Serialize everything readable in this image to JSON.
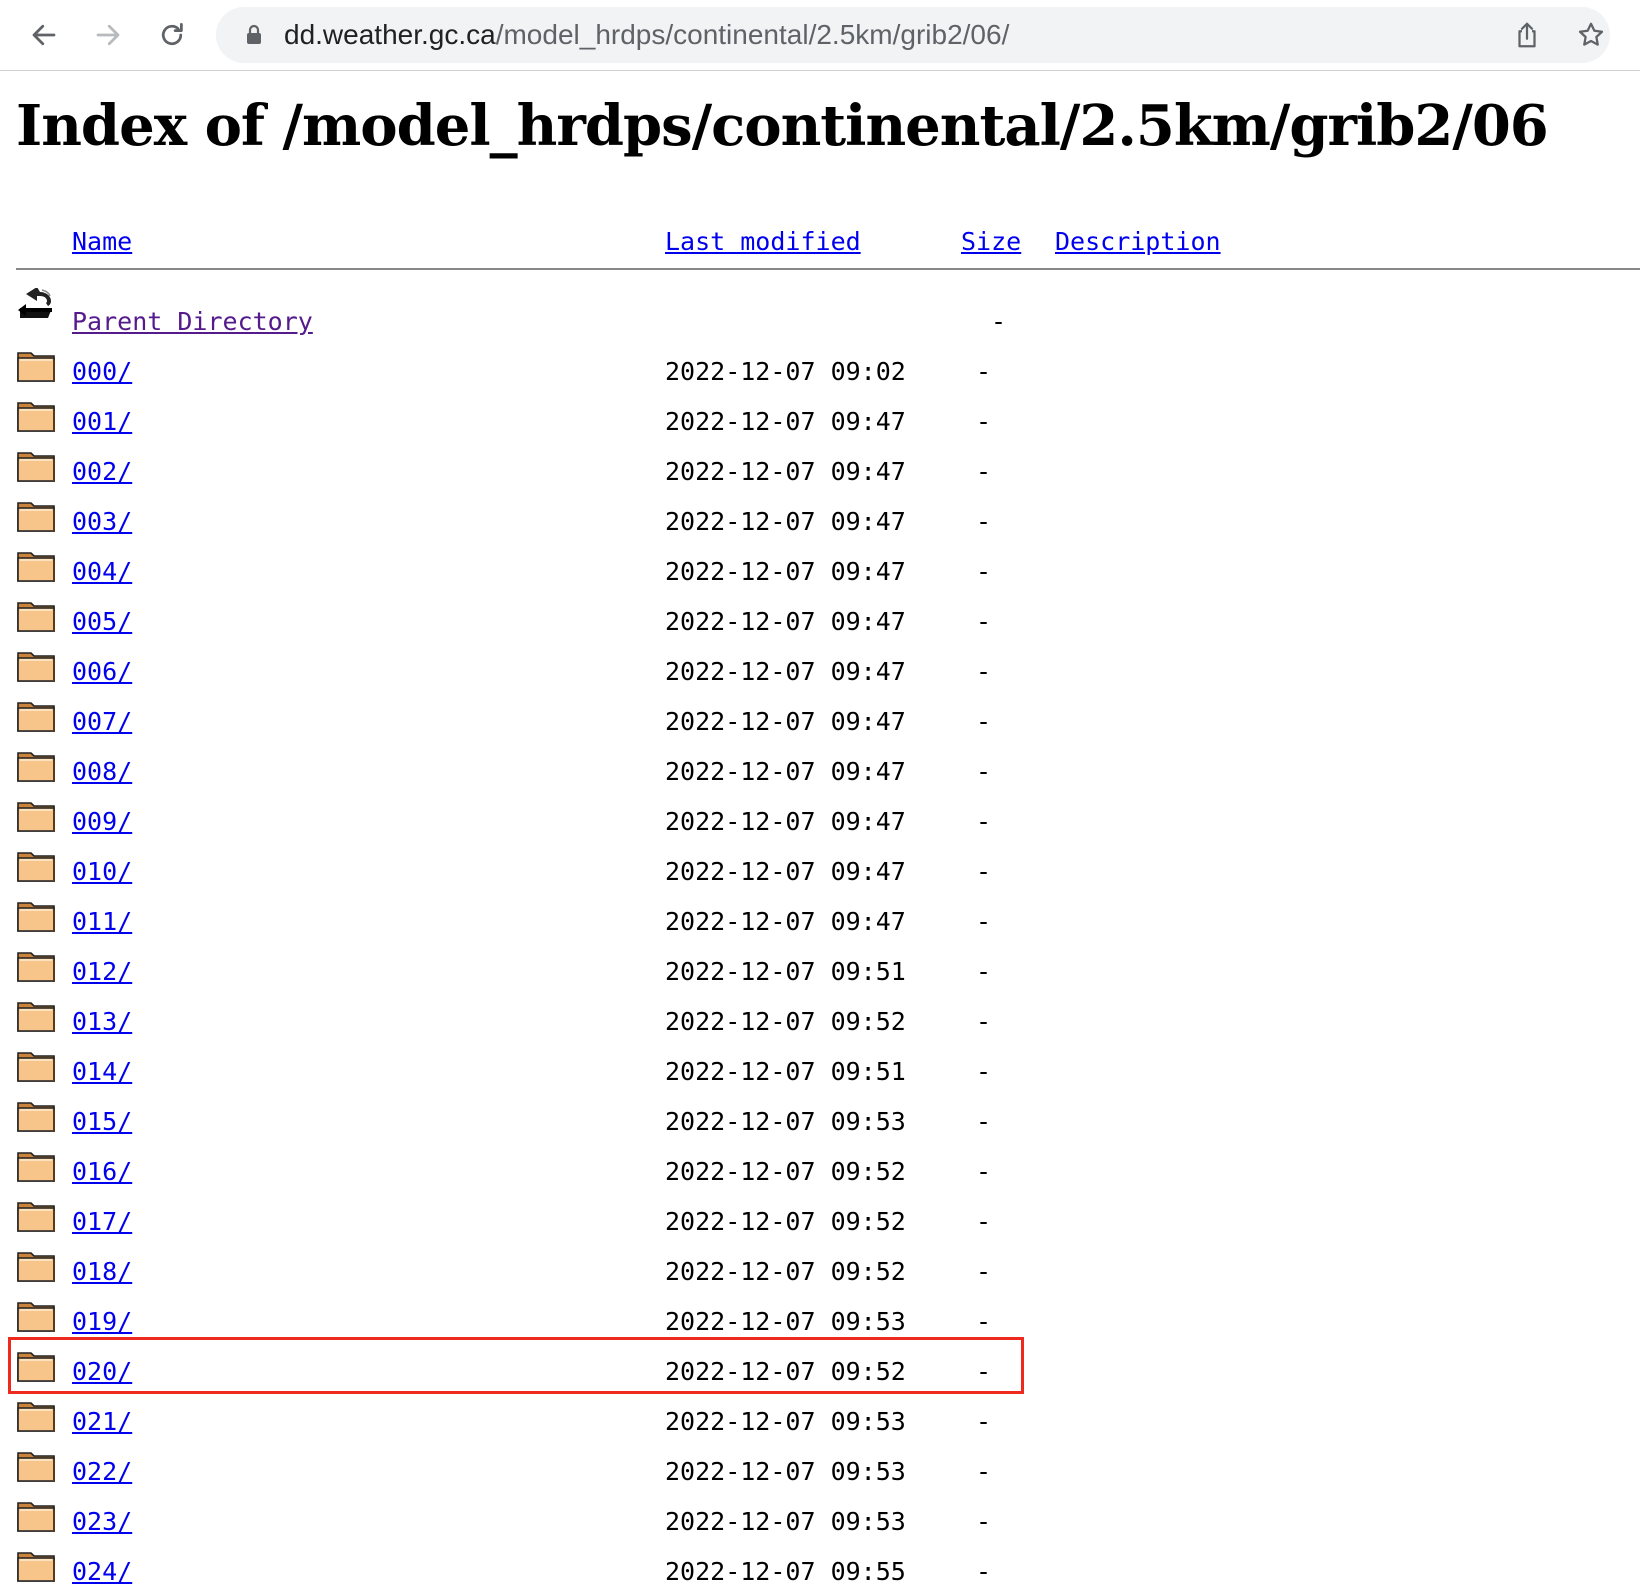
{
  "browser": {
    "url_host": "dd.weather.gc.ca",
    "url_path": "/model_hrdps/continental/2.5km/grib2/06/"
  },
  "page": {
    "title": "Index of /model_hrdps/continental/2.5km/grib2/06",
    "columns": {
      "name": "Name",
      "last_modified": "Last modified",
      "size": "Size",
      "description": "Description"
    },
    "parent": {
      "label": "Parent Directory",
      "size": "-"
    },
    "rows": [
      {
        "name": "000/",
        "modified": "2022-12-07 09:02",
        "size": "-"
      },
      {
        "name": "001/",
        "modified": "2022-12-07 09:47",
        "size": "-"
      },
      {
        "name": "002/",
        "modified": "2022-12-07 09:47",
        "size": "-"
      },
      {
        "name": "003/",
        "modified": "2022-12-07 09:47",
        "size": "-"
      },
      {
        "name": "004/",
        "modified": "2022-12-07 09:47",
        "size": "-"
      },
      {
        "name": "005/",
        "modified": "2022-12-07 09:47",
        "size": "-"
      },
      {
        "name": "006/",
        "modified": "2022-12-07 09:47",
        "size": "-"
      },
      {
        "name": "007/",
        "modified": "2022-12-07 09:47",
        "size": "-"
      },
      {
        "name": "008/",
        "modified": "2022-12-07 09:47",
        "size": "-"
      },
      {
        "name": "009/",
        "modified": "2022-12-07 09:47",
        "size": "-"
      },
      {
        "name": "010/",
        "modified": "2022-12-07 09:47",
        "size": "-"
      },
      {
        "name": "011/",
        "modified": "2022-12-07 09:47",
        "size": "-"
      },
      {
        "name": "012/",
        "modified": "2022-12-07 09:51",
        "size": "-"
      },
      {
        "name": "013/",
        "modified": "2022-12-07 09:52",
        "size": "-"
      },
      {
        "name": "014/",
        "modified": "2022-12-07 09:51",
        "size": "-"
      },
      {
        "name": "015/",
        "modified": "2022-12-07 09:53",
        "size": "-"
      },
      {
        "name": "016/",
        "modified": "2022-12-07 09:52",
        "size": "-"
      },
      {
        "name": "017/",
        "modified": "2022-12-07 09:52",
        "size": "-"
      },
      {
        "name": "018/",
        "modified": "2022-12-07 09:52",
        "size": "-"
      },
      {
        "name": "019/",
        "modified": "2022-12-07 09:53",
        "size": "-"
      },
      {
        "name": "020/",
        "modified": "2022-12-07 09:52",
        "size": "-"
      },
      {
        "name": "021/",
        "modified": "2022-12-07 09:53",
        "size": "-"
      },
      {
        "name": "022/",
        "modified": "2022-12-07 09:53",
        "size": "-"
      },
      {
        "name": "023/",
        "modified": "2022-12-07 09:53",
        "size": "-"
      },
      {
        "name": "024/",
        "modified": "2022-12-07 09:55",
        "size": "-"
      }
    ],
    "highlighted_row": "020/",
    "highlight_color": "#ee2a1e",
    "link_color": "#0000ee",
    "visited_link_color": "#551a8b"
  },
  "icons": {
    "back": "back-arrow-icon",
    "forward": "forward-arrow-icon",
    "reload": "reload-icon",
    "lock": "lock-icon",
    "share": "share-icon",
    "bookmark": "star-icon",
    "parent": "back-folder-icon",
    "folder": "folder-icon"
  }
}
